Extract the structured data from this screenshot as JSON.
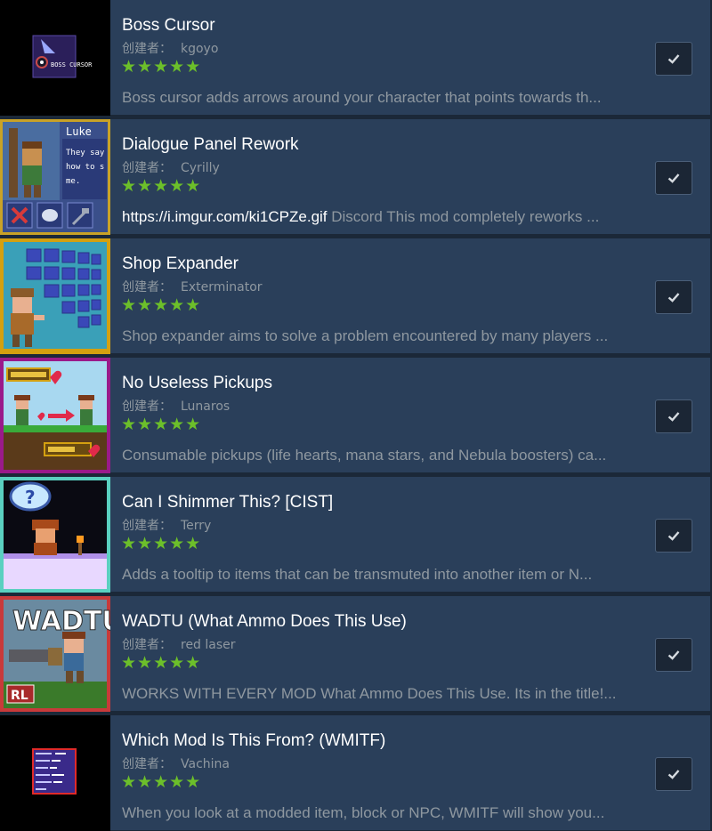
{
  "author_prefix": "创建者：",
  "colors": {
    "background": "#1b2838",
    "row": "#2a3f5a",
    "star": "#6cbf2a",
    "muted_text": "#8f98a0"
  },
  "items": [
    {
      "title": "Boss Cursor",
      "author": "kgoyo",
      "stars": "★★★★★",
      "rating": 5,
      "description": "Boss cursor adds arrows around your character that points towards th...",
      "thumbnail": "boss-cursor-thumbnail",
      "thumb_text": "BOSS CURSOR",
      "checked": true
    },
    {
      "title": "Dialogue Panel Rework",
      "author": "Cyrilly",
      "stars": "★★★★★",
      "rating": 5,
      "description_link": "https://i.imgur.com/ki1CPZe.gif",
      "description": " Discord This mod completely reworks ...",
      "thumbnail": "dialogue-panel-thumbnail",
      "thumb_text": "Luke",
      "thumb_text2": "They say how to s me.",
      "checked": true
    },
    {
      "title": "Shop Expander",
      "author": "Exterminator",
      "stars": "★★★★★",
      "rating": 5,
      "description": "Shop expander aims to solve a problem encountered by many players ...",
      "thumbnail": "shop-expander-thumbnail",
      "checked": true
    },
    {
      "title": "No Useless Pickups",
      "author": "Lunaros",
      "stars": "★★★★★",
      "rating": 5,
      "description": "Consumable pickups (life hearts, mana stars, and Nebula boosters) ca...",
      "thumbnail": "no-useless-pickups-thumbnail",
      "checked": true
    },
    {
      "title": "Can I Shimmer This? [CIST]",
      "author": "Terry",
      "stars": "★★★★★",
      "rating": 5,
      "description": "Adds a tooltip to items that can be transmuted into another item or N...",
      "thumbnail": "shimmer-thumbnail",
      "checked": true
    },
    {
      "title": "WADTU (What Ammo Does This Use)",
      "author": "red laser",
      "stars": "★★★★★",
      "rating": 5,
      "description": "WORKS WITH EVERY MOD What Ammo Does This Use. Its in the title!...",
      "thumbnail": "wadtu-thumbnail",
      "thumb_text": "WADTU",
      "thumb_text2": "RL",
      "checked": true
    },
    {
      "title": "Which Mod Is This From? (WMITF)",
      "author": "Vachina",
      "stars": "★★★★★",
      "rating": 5,
      "description": "When you look at a modded item, block or NPC, WMITF will show you...",
      "thumbnail": "wmitf-thumbnail",
      "checked": true
    }
  ]
}
